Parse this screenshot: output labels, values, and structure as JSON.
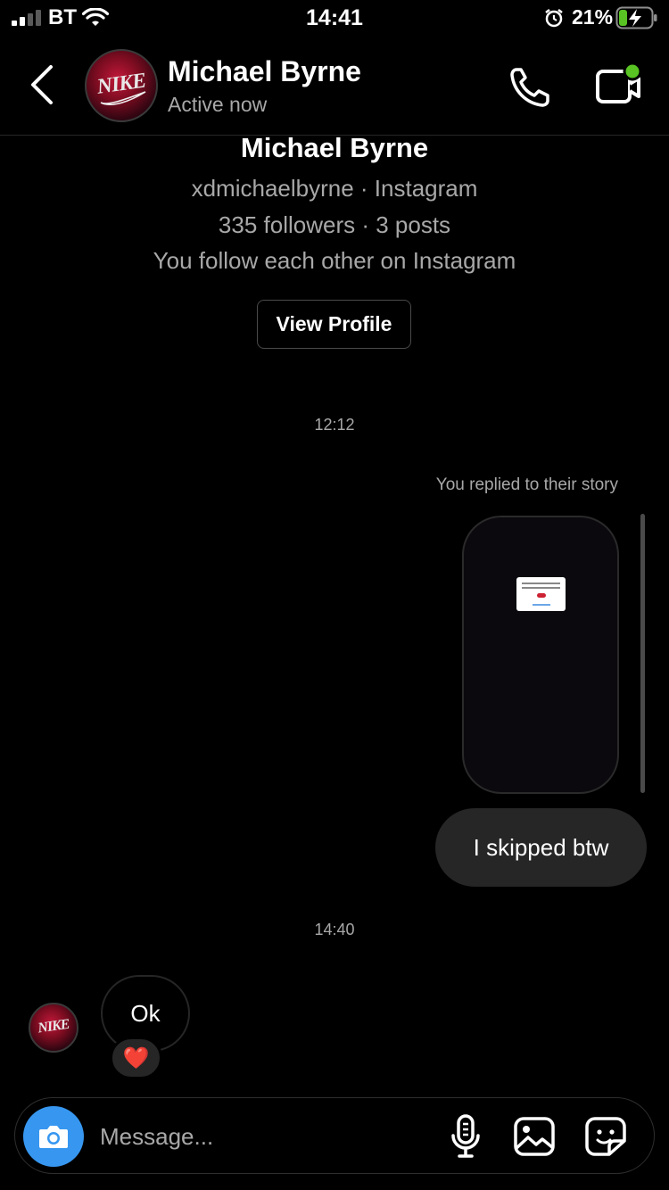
{
  "status_bar": {
    "carrier": "BT",
    "time": "14:41",
    "battery": "21%"
  },
  "header": {
    "name": "Michael Byrne",
    "status": "Active now",
    "avatar_text": "NIKE"
  },
  "profile": {
    "name": "Michael Byrne",
    "handle_line": "xdmichaelbyrne · Instagram",
    "stats_line": "335 followers · 3 posts",
    "mutual_line": "You follow each other on Instagram",
    "view_profile_label": "View Profile"
  },
  "messages": {
    "timestamp_1": "12:12",
    "story_reply_label": "You replied to their story",
    "outgoing_text": "I skipped btw",
    "timestamp_2": "14:40",
    "incoming_text": "Ok",
    "reaction": "❤️"
  },
  "composer": {
    "placeholder": "Message..."
  },
  "colors": {
    "accent": "#3797f0",
    "online": "#58c322",
    "bubble": "#262626",
    "muted_text": "#a8a8a8"
  }
}
